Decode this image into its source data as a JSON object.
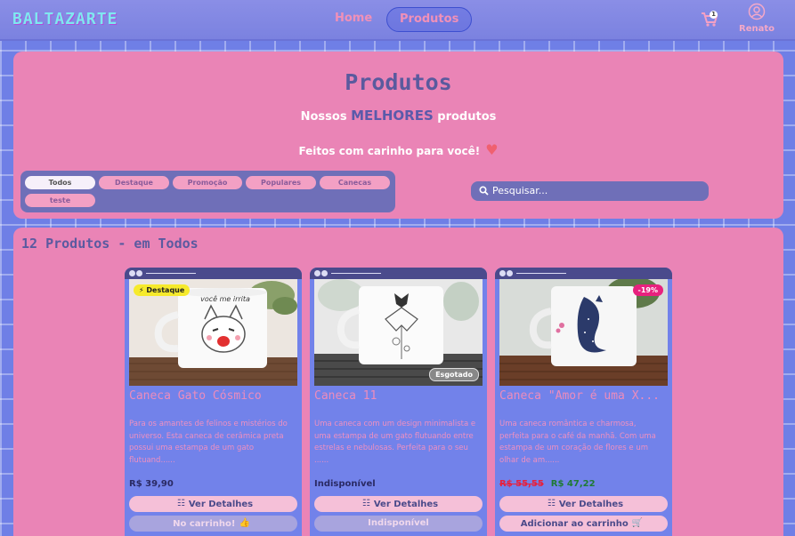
{
  "header": {
    "logo": "BALTAZARTE",
    "nav": [
      {
        "label": "Home"
      },
      {
        "label": "Produtos"
      }
    ],
    "cart_count": "1",
    "user_name": "Renato"
  },
  "hero": {
    "title": "Produtos",
    "subtitle_pre": "Nossos",
    "subtitle_highlight": "MELHORES",
    "subtitle_post": "produtos",
    "tagline": "Feitos com carinho para você!"
  },
  "filters": [
    "Todos",
    "Destaque",
    "Promoção",
    "Populares",
    "Canecas",
    "teste"
  ],
  "search": {
    "placeholder": "Pesquisar..."
  },
  "products_section": {
    "count_title": "12 Produtos - em Todos"
  },
  "products": [
    {
      "badge": "Destaque",
      "title": "Caneca Gato Cósmico",
      "description": "Para os amantes de felinos e mistérios do universo. Esta caneca de cerâmica preta possui uma estampa de um gato flutuand......",
      "price": "R$ 39,90",
      "details_label": "Ver Detalhes",
      "action_label": "No carrinho!",
      "mug_text": "você me irrita"
    },
    {
      "badge": "Esgotado",
      "title": "Caneca 11",
      "description": "Uma caneca com um design minimalista e uma estampa de um gato flutuando entre estrelas e nebulosas. Perfeita para o seu ......",
      "price": "Indisponível",
      "details_label": "Ver Detalhes",
      "action_label": "Indisponível"
    },
    {
      "badge": "-19%",
      "title": "Caneca \"Amor é uma X...",
      "description": "Uma caneca romântica e charmosa, perfeita para o café da manhã. Com uma estampa de um coração de flores e um olhar de am......",
      "price_old": "R$ 55,55",
      "price": "R$ 47,22",
      "details_label": "Ver Detalhes",
      "action_label": "Adicionar ao carrinho"
    }
  ],
  "colors": {
    "background": "#6f7fe6",
    "panel": "#ea84b6",
    "card": "#7282ea",
    "accent_yellow": "#f6ea2c",
    "accent_discount": "#e8217e"
  }
}
